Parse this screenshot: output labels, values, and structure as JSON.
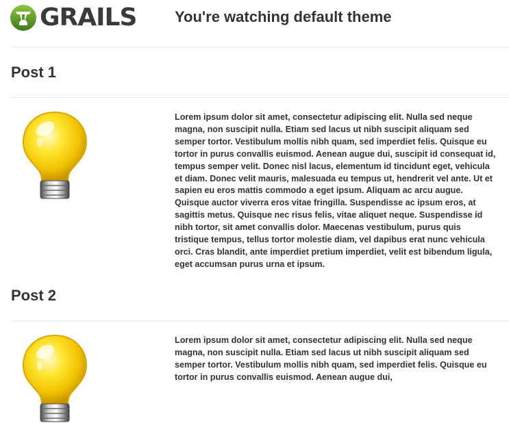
{
  "header": {
    "logo_text": "GRAILS",
    "theme_title": "You're watching default theme"
  },
  "posts": [
    {
      "title": "Post 1",
      "body": "Lorem ipsum dolor sit amet, consectetur adipiscing elit. Nulla sed neque magna, non suscipit nulla. Etiam sed lacus ut nibh suscipit aliquam sed semper tortor. Vestibulum mollis nibh quam, sed imperdiet felis. Quisque eu tortor in purus convallis euismod. Aenean augue dui, suscipit id consequat id, tempus semper velit. Donec nisl lacus, elementum id tincidunt eget, vehicula et diam. Donec velit mauris, malesuada eu tempus ut, hendrerit vel ante. Ut et sapien eu eros mattis commodo a eget ipsum. Aliquam ac arcu augue. Quisque auctor viverra eros vitae fringilla. Suspendisse ac ipsum eros, at sagittis metus. Quisque nec risus felis, vitae aliquet neque. Suspendisse id nibh tortor, sit amet convallis dolor. Maecenas vestibulum, purus quis tristique tempus, tellus tortor molestie diam, vel dapibus erat nunc vehicula orci. Cras blandit, ante imperdiet pretium imperdiet, velit est bibendum ligula, eget accumsan purus urna et ipsum.",
      "icon": "lightbulb-icon"
    },
    {
      "title": "Post 2",
      "body": "Lorem ipsum dolor sit amet, consectetur adipiscing elit. Nulla sed neque magna, non suscipit nulla. Etiam sed lacus ut nibh suscipit aliquam sed semper tortor. Vestibulum mollis nibh quam, sed imperdiet felis. Quisque eu tortor in purus convallis euismod. Aenean augue dui,",
      "icon": "lightbulb-icon"
    }
  ],
  "colors": {
    "text": "#333333",
    "divider": "#e6e6e6",
    "logo_green": "#5a9e2f",
    "bulb_yellow": "#f5d100"
  }
}
